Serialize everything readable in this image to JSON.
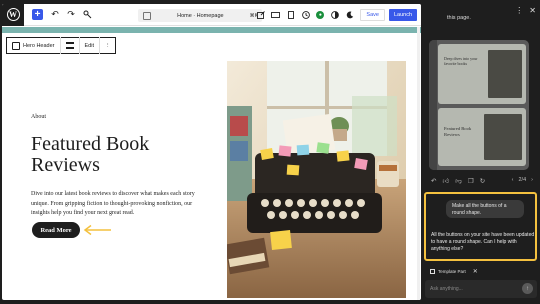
{
  "toolbar": {
    "add_icon": "+",
    "undo_icon": "↶",
    "redo_icon": "↷",
    "tools_icon": "⚙",
    "doc_title": "Home · Homepage",
    "shortcut": "⌘K",
    "save_label": "Save",
    "launch_label": "Launch"
  },
  "block_toolbar": {
    "block_name": "Hero Header",
    "edit_label": "Edit",
    "more_icon": "⋮"
  },
  "hero": {
    "eyebrow": "About",
    "title": "Featured Book Reviews",
    "description": "Dive into our latest book reviews to discover what makes each story unique. From gripping fiction to thought-provoking nonfiction, our insights help you find your next great read.",
    "button_label": "Read More"
  },
  "panel": {
    "top_text": "this page.",
    "more_icon": "⋮",
    "close_icon": "✕",
    "preview": {
      "card1_title": "Deep dives into your favorite books",
      "card2_title": "Featured Book Reviews"
    },
    "pager": {
      "prev": "‹",
      "label": "2/4",
      "next": "›"
    },
    "chat": {
      "user_message": "Make all the buttons of a round shape.",
      "ai_message": "All the buttons on your site have been updated to have a round shape. Can I help with anything else?"
    },
    "chip": {
      "label": "Template Part",
      "remove_icon": "✕"
    },
    "input": {
      "placeholder": "Ask anything...",
      "send_icon": "↑"
    }
  },
  "colors": {
    "accent": "#3858e9",
    "highlight": "#f4c13f",
    "teal_band": "#7ab3ae",
    "status_green": "#1a8f3c"
  }
}
